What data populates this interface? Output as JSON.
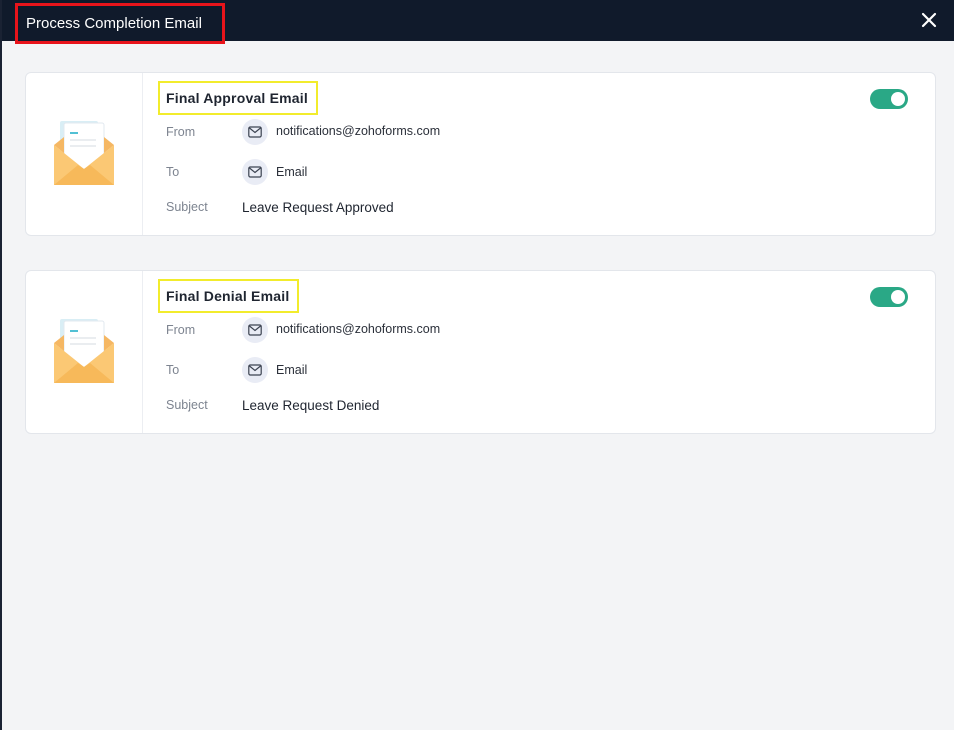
{
  "header": {
    "title": "Process Completion Email"
  },
  "icons": {
    "close": "close-icon",
    "envelope": "envelope-illustration-icon",
    "mail": "mail-icon"
  },
  "colors": {
    "header_bg": "#101a2b",
    "toggle_on": "#2aa886",
    "highlight_red": "#e8141b",
    "highlight_yellow": "#f2ec2c"
  },
  "cards": [
    {
      "title": "Final Approval Email",
      "enabled": true,
      "from_label": "From",
      "from_value": "notifications@zohoforms.com",
      "to_label": "To",
      "to_value": "Email",
      "subject_label": "Subject",
      "subject_value": "Leave Request Approved"
    },
    {
      "title": "Final Denial Email",
      "enabled": true,
      "from_label": "From",
      "from_value": "notifications@zohoforms.com",
      "to_label": "To",
      "to_value": "Email",
      "subject_label": "Subject",
      "subject_value": "Leave Request Denied"
    }
  ]
}
